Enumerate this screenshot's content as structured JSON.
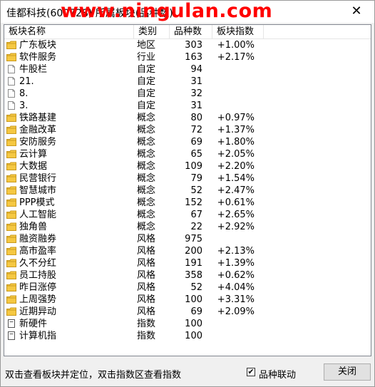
{
  "window": {
    "title": "佳都科技(600728) 所属板块(品种数)",
    "watermark": "www.ningulan.com",
    "close_glyph": "✕"
  },
  "columns": [
    "板块名称",
    "类别",
    "品种数",
    "板块指数"
  ],
  "rows": [
    {
      "icon": "folder-icon",
      "name": "广东板块",
      "type": "地区",
      "count": "303",
      "index": "+1.00%"
    },
    {
      "icon": "folder-icon",
      "name": "软件服务",
      "type": "行业",
      "count": "163",
      "index": "+2.17%"
    },
    {
      "icon": "page-icon",
      "name": "牛股栏",
      "type": "自定",
      "count": "94",
      "index": ""
    },
    {
      "icon": "page-icon",
      "name": "21.",
      "type": "自定",
      "count": "31",
      "index": ""
    },
    {
      "icon": "page-icon",
      "name": "8.",
      "type": "自定",
      "count": "32",
      "index": ""
    },
    {
      "icon": "page-icon",
      "name": "3.",
      "type": "自定",
      "count": "31",
      "index": ""
    },
    {
      "icon": "folder-icon",
      "name": "铁路基建",
      "type": "概念",
      "count": "80",
      "index": "+0.97%"
    },
    {
      "icon": "folder-icon",
      "name": "金融改革",
      "type": "概念",
      "count": "72",
      "index": "+1.37%"
    },
    {
      "icon": "folder-icon",
      "name": "安防服务",
      "type": "概念",
      "count": "69",
      "index": "+1.80%"
    },
    {
      "icon": "folder-icon",
      "name": "云计算",
      "type": "概念",
      "count": "65",
      "index": "+2.05%"
    },
    {
      "icon": "folder-icon",
      "name": "大数据",
      "type": "概念",
      "count": "109",
      "index": "+2.20%"
    },
    {
      "icon": "folder-icon",
      "name": "民营银行",
      "type": "概念",
      "count": "79",
      "index": "+1.54%"
    },
    {
      "icon": "folder-icon",
      "name": "智慧城市",
      "type": "概念",
      "count": "52",
      "index": "+2.47%"
    },
    {
      "icon": "folder-icon",
      "name": "PPP模式",
      "type": "概念",
      "count": "152",
      "index": "+0.61%"
    },
    {
      "icon": "folder-icon",
      "name": "人工智能",
      "type": "概念",
      "count": "67",
      "index": "+2.65%"
    },
    {
      "icon": "folder-icon",
      "name": "独角兽",
      "type": "概念",
      "count": "22",
      "index": "+2.92%"
    },
    {
      "icon": "folder-icon",
      "name": "融资融券",
      "type": "风格",
      "count": "975",
      "index": ""
    },
    {
      "icon": "folder-icon",
      "name": "高市盈率",
      "type": "风格",
      "count": "200",
      "index": "+2.13%"
    },
    {
      "icon": "folder-icon",
      "name": "久不分红",
      "type": "风格",
      "count": "191",
      "index": "+1.39%"
    },
    {
      "icon": "folder-icon",
      "name": "员工持股",
      "type": "风格",
      "count": "358",
      "index": "+0.62%"
    },
    {
      "icon": "folder-icon",
      "name": "昨日涨停",
      "type": "风格",
      "count": "52",
      "index": "+4.04%"
    },
    {
      "icon": "folder-icon",
      "name": "上周强势",
      "type": "风格",
      "count": "100",
      "index": "+3.31%"
    },
    {
      "icon": "folder-icon",
      "name": "近期异动",
      "type": "风格",
      "count": "69",
      "index": "+2.09%"
    },
    {
      "icon": "doc-icon",
      "name": "新硬件",
      "type": "指数",
      "count": "100",
      "index": ""
    },
    {
      "icon": "doc-icon",
      "name": "计算机指",
      "type": "指数",
      "count": "100",
      "index": ""
    }
  ],
  "status": {
    "hint": "双击查看板块并定位，双击指数区查看指数",
    "checkbox_label": "品种联动",
    "checkbox_checked": true,
    "close_label": "关闭"
  },
  "colors": {
    "folder": "#f5c842",
    "folder_edge": "#c99a1e",
    "page": "#ffffff",
    "page_edge": "#8a8a8a",
    "watermark": "#ff0000"
  }
}
